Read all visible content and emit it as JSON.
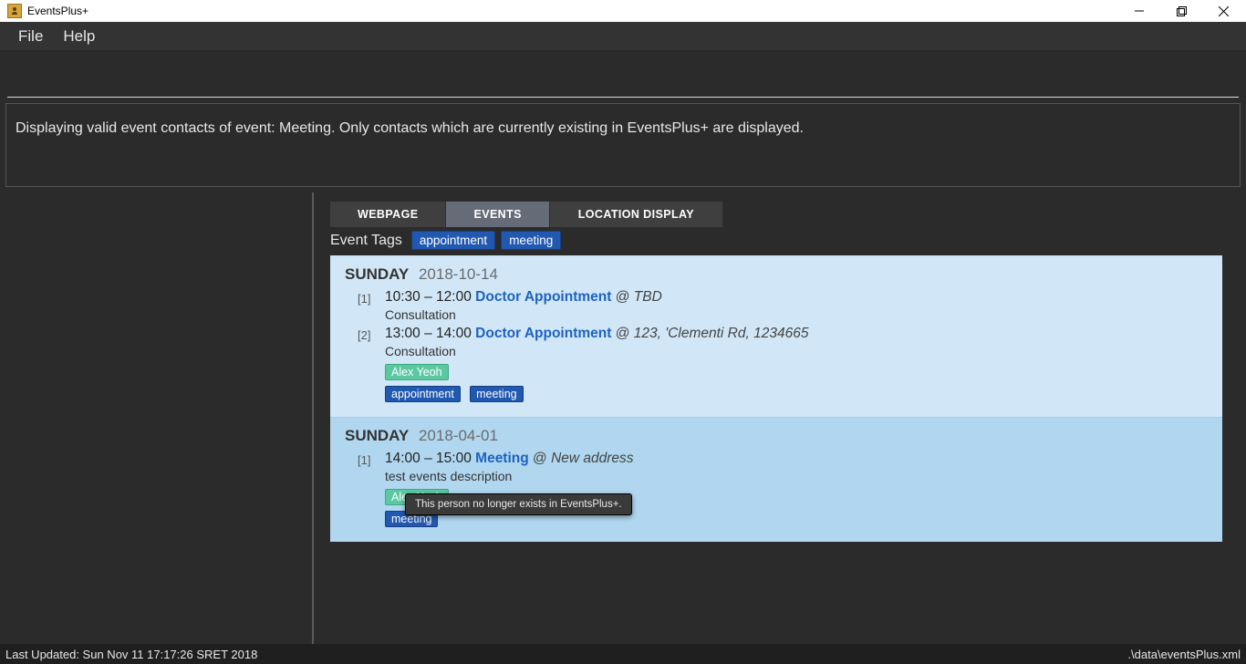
{
  "window": {
    "title": "EventsPlus+"
  },
  "menu": {
    "file": "File",
    "help": "Help"
  },
  "result_message": "Displaying valid event contacts of event: Meeting. Only contacts which are currently existing in EventsPlus+ are displayed.",
  "tabs": {
    "webpage": "WEBPAGE",
    "events": "EVENTS",
    "location": "LOCATION DISPLAY"
  },
  "tagrow": {
    "label": "Event Tags",
    "tags": [
      "appointment",
      "meeting"
    ]
  },
  "days": [
    {
      "dow": "SUNDAY",
      "date": "2018-10-14",
      "tone": "light",
      "events": [
        {
          "idx": "[1]",
          "start": "10:30",
          "end": "12:00",
          "title": "Doctor Appointment",
          "at": "@",
          "location": "TBD",
          "description": "Consultation",
          "people": [],
          "tags": []
        },
        {
          "idx": "[2]",
          "start": "13:00",
          "end": "14:00",
          "title": "Doctor Appointment",
          "at": "@",
          "location": "123, 'Clementi Rd, 1234665",
          "description": "Consultation",
          "people": [
            "Alex Yeoh"
          ],
          "tags": [
            "appointment",
            "meeting"
          ]
        }
      ]
    },
    {
      "dow": "SUNDAY",
      "date": "2018-04-01",
      "tone": "dark",
      "events": [
        {
          "idx": "[1]",
          "start": "14:00",
          "end": "15:00",
          "title": "Meeting",
          "at": "@",
          "location": "New address",
          "description": "test events description",
          "people": [
            "Alex Yeoh"
          ],
          "tags": [
            "meeting"
          ]
        }
      ]
    }
  ],
  "tooltip": "This person no longer exists in EventsPlus+.",
  "status": {
    "left": "Last Updated: Sun Nov 11 17:17:26 SRET 2018",
    "right": ".\\data\\eventsPlus.xml"
  },
  "glyph": {
    "dash": "–"
  }
}
